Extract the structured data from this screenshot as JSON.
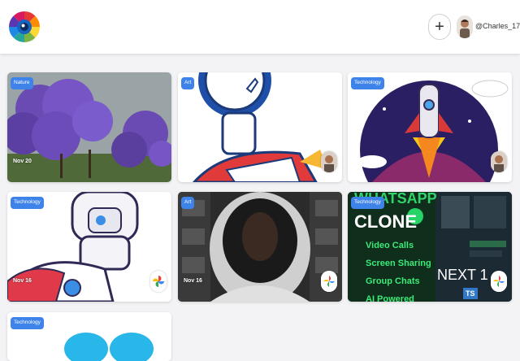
{
  "header": {
    "add_label": "+",
    "username": "@Charles_17"
  },
  "cards": [
    {
      "tag": "Nature",
      "date": "Nov 20",
      "author": "none"
    },
    {
      "tag": "Art",
      "date": "",
      "author": "user-photo"
    },
    {
      "tag": "Technology",
      "date": "",
      "author": "user-photo"
    },
    {
      "tag": "Technology",
      "date": "Nov 16",
      "author": "google-photos"
    },
    {
      "tag": "Art",
      "date": "Nov 16",
      "author": "google-photos"
    },
    {
      "tag": "Technology",
      "date": "",
      "author": "google-photos",
      "image_text": {
        "title1": "WHATSAPP",
        "title2": "CLONE",
        "f1": "Video Calls",
        "f2": "Screen Sharing",
        "f3": "Group Chats",
        "f4": "AI Powered",
        "next": "NEXT 1",
        "ts": "TS"
      }
    },
    {
      "tag": "Technology",
      "date": "",
      "author": "none"
    }
  ],
  "colors": {
    "accent": "#3d83ea",
    "header_bg": "#ffffff",
    "page_bg": "#f3f3f5"
  }
}
